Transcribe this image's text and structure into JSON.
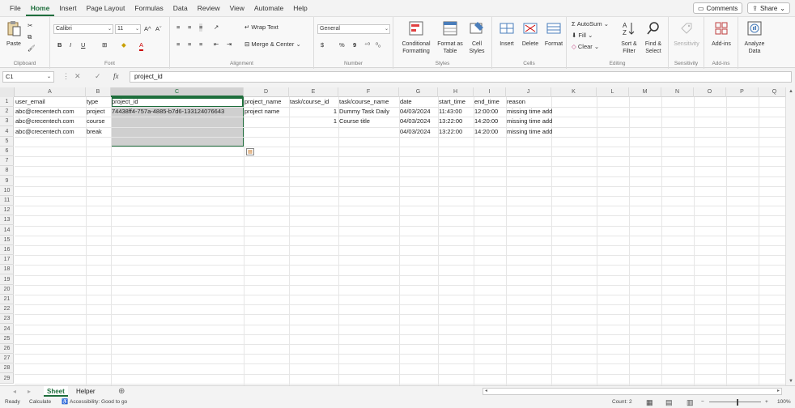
{
  "menu": {
    "tabs": [
      "File",
      "Home",
      "Insert",
      "Page Layout",
      "Formulas",
      "Data",
      "Review",
      "View",
      "Automate",
      "Help"
    ],
    "active": "Home",
    "comments": "Comments",
    "share": "Share"
  },
  "ribbon": {
    "clipboard": {
      "paste": "Paste",
      "label": "Clipboard"
    },
    "font": {
      "name": "Calibri",
      "size": "11",
      "label": "Font",
      "bold": "B",
      "italic": "I",
      "underline": "U",
      "grow": "A^",
      "shrink": "Aˇ",
      "color": "A"
    },
    "alignment": {
      "wrap": "Wrap Text",
      "merge": "Merge & Center",
      "label": "Alignment"
    },
    "number": {
      "format": "General",
      "currency": "$",
      "percent": "%",
      "comma": "9",
      "label": "Number"
    },
    "styles": {
      "conditional": "Conditional Formatting",
      "format_as": "Format as Table",
      "cell_styles": "Cell Styles",
      "label": "Styles"
    },
    "cells": {
      "insert": "Insert",
      "delete": "Delete",
      "format": "Format",
      "label": "Cells"
    },
    "editing": {
      "autosum": "AutoSum",
      "fill": "Fill",
      "clear": "Clear",
      "sort": "Sort & Filter",
      "find": "Find & Select",
      "label": "Editing"
    },
    "sensitivity": {
      "button": "Sensitivity",
      "label": "Sensitivity"
    },
    "addins": {
      "button": "Add-ins",
      "label": "Add-ins"
    },
    "analyze": {
      "button": "Analyze Data"
    }
  },
  "formula_bar": {
    "name_box": "C1",
    "fx": "fx",
    "content": "project_id"
  },
  "columns": [
    "A",
    "B",
    "C",
    "D",
    "E",
    "F",
    "G",
    "H",
    "I",
    "J",
    "K",
    "L",
    "M",
    "N",
    "O",
    "P",
    "Q"
  ],
  "rows": [
    "1",
    "2",
    "3",
    "4",
    "5",
    "6",
    "7",
    "8",
    "9",
    "10",
    "11",
    "12",
    "13",
    "14",
    "15",
    "16",
    "17",
    "18",
    "19",
    "20",
    "21",
    "22",
    "23",
    "24",
    "25",
    "26",
    "27",
    "28",
    "29"
  ],
  "sheet": {
    "header": [
      "user_email",
      "type",
      "project_id",
      "project_name",
      "task/course_id",
      "task/course_name",
      "date",
      "start_time",
      "end_time",
      "reason"
    ],
    "data": [
      [
        "abc@crecentech.com",
        "project",
        "74438ff4-757a-4885-b7d6-133124076643",
        "project name",
        "1",
        "Dummy Task Daily",
        "04/03/2024",
        "11:43:00",
        "12:00:00",
        "missing time add"
      ],
      [
        "abc@crecentech.com",
        "course",
        "",
        "",
        "1",
        "Course title",
        "04/03/2024",
        "13:22:00",
        "14:20:00",
        "missing time add"
      ],
      [
        "abc@crecentech.com",
        "break",
        "",
        "",
        "",
        "",
        "04/03/2024",
        "13:22:00",
        "14:20:00",
        "missing time add"
      ]
    ]
  },
  "sheet_tabs": [
    "Sheet",
    "Helper"
  ],
  "active_sheet": "Sheet",
  "status": {
    "ready": "Ready",
    "calculate": "Calculate",
    "accessibility": "Accessibility: Good to go",
    "count": "Count: 2",
    "zoom": "100%"
  }
}
